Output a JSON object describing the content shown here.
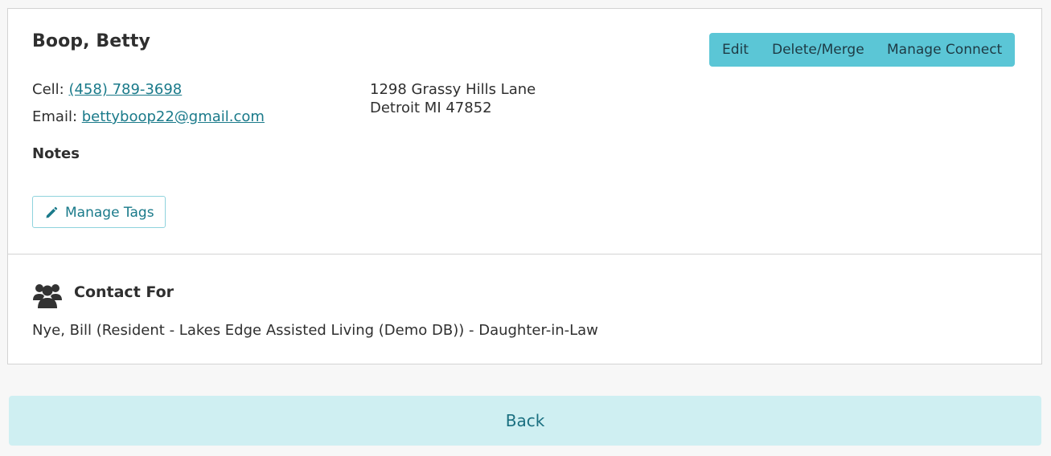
{
  "contact": {
    "name": "Boop, Betty",
    "cell_label": "Cell:",
    "cell_value": "(458) 789-3698",
    "email_label": "Email:",
    "email_value": "bettyboop22@gmail.com",
    "address_line1": "1298 Grassy Hills Lane",
    "address_line2": "Detroit MI 47852",
    "notes_label": "Notes"
  },
  "actions": {
    "edit_label": "Edit",
    "delete_merge_label": "Delete/Merge",
    "manage_connect_label": "Manage Connect",
    "color": "#5bc6d6"
  },
  "tags": {
    "manage_tags_label": "Manage Tags",
    "icon": "pencil-icon"
  },
  "contact_for": {
    "title": "Contact For",
    "icon": "users-icon",
    "items": [
      "Nye, Bill (Resident - Lakes Edge Assisted Living (Demo DB)) - Daughter-in-Law"
    ]
  },
  "footer": {
    "back_label": "Back",
    "color": "#cfeff2"
  }
}
